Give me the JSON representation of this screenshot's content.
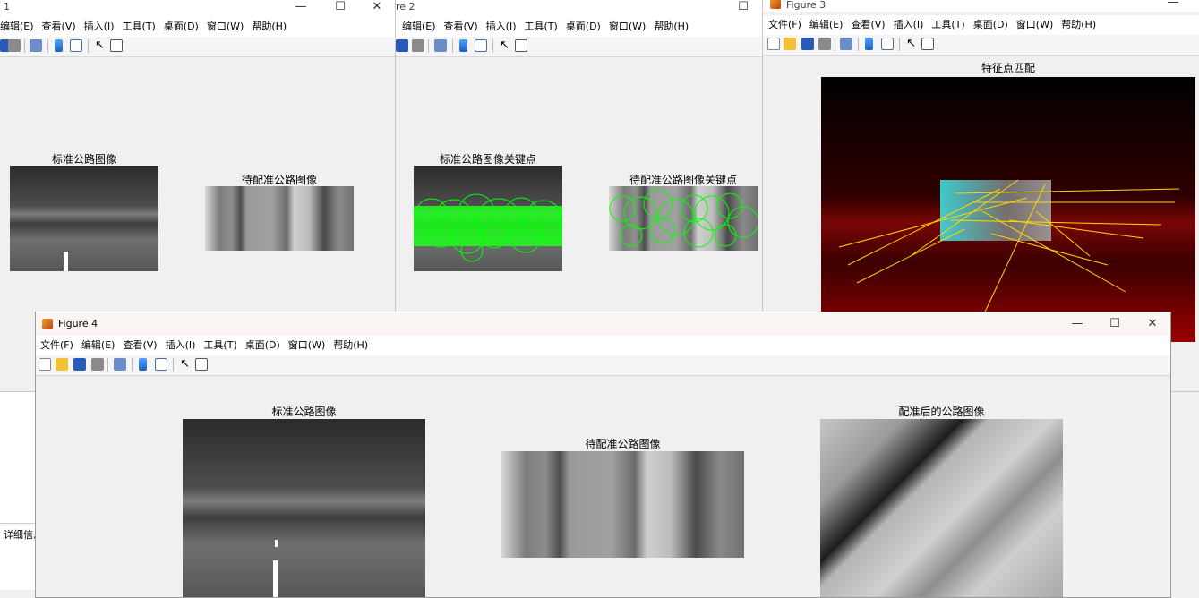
{
  "windows": {
    "fig1": {
      "title": "1",
      "menu": [
        "编辑(E)",
        "查看(V)",
        "插入(I)",
        "工具(T)",
        "桌面(D)",
        "窗口(W)",
        "帮助(H)"
      ],
      "plot_titles": [
        "标准公路图像",
        "待配准公路图像"
      ]
    },
    "fig2": {
      "title": "re 2",
      "menu": [
        "编辑(E)",
        "查看(V)",
        "插入(I)",
        "工具(T)",
        "桌面(D)",
        "窗口(W)",
        "帮助(H)"
      ],
      "plot_titles": [
        "标准公路图像关键点",
        "待配准公路图像关键点"
      ]
    },
    "fig3": {
      "title": "Figure 3",
      "menu": [
        "文件(F)",
        "编辑(E)",
        "查看(V)",
        "插入(I)",
        "工具(T)",
        "桌面(D)",
        "窗口(W)",
        "帮助(H)"
      ],
      "plot_title": "特征点匹配"
    },
    "fig4": {
      "title": "Figure 4",
      "menu": [
        "文件(F)",
        "编辑(E)",
        "查看(V)",
        "插入(I)",
        "工具(T)",
        "桌面(D)",
        "窗口(W)",
        "帮助(H)"
      ],
      "plot_titles": [
        "标准公路图像",
        "待配准公路图像",
        "配准后的公路图像"
      ]
    }
  },
  "background_panel": {
    "label": "详细信息"
  },
  "window_controls": {
    "minimize": "—",
    "maximize": "☐",
    "close": "✕"
  },
  "colors": {
    "keypoint": "#00ff00",
    "match_line": "#ffd700",
    "accent": "#0078d4"
  }
}
